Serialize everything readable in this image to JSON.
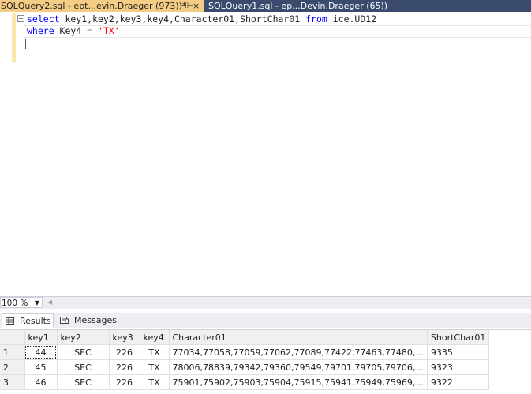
{
  "tabs": [
    {
      "title": "SQLQuery2.sql - ept...evin.Draeger (973))*",
      "pin": "⊣⊢",
      "close": "×",
      "active": true
    },
    {
      "title": "SQLQuery1.sql - ep...Devin.Draeger (65))*",
      "active": false
    }
  ],
  "editor": {
    "line1": {
      "kw1": "select",
      "cols": " key1,key2,key3,key4,Character01,ShortChar01 ",
      "kw2": "from",
      "table": " ice.UD12"
    },
    "line2": {
      "kw": "where",
      "cond": " Key4 ",
      "op": "=",
      "str": " 'TX'"
    }
  },
  "zoom": {
    "value": "100 %"
  },
  "result_tabs": {
    "results": "Results",
    "messages": "Messages"
  },
  "grid": {
    "columns": [
      "key1",
      "key2",
      "key3",
      "key4",
      "Character01",
      "ShortChar01"
    ],
    "rows": [
      {
        "num": "1",
        "key1": "44",
        "key2": "SEC",
        "key3": "226",
        "key4": "TX",
        "char01": "77034,77058,77059,77062,77089,77422,77463,77480,...",
        "short01": "9335"
      },
      {
        "num": "2",
        "key1": "45",
        "key2": "SEC",
        "key3": "226",
        "key4": "TX",
        "char01": "78006,78839,79342,79360,79549,79701,79705,79706,...",
        "short01": "9323"
      },
      {
        "num": "3",
        "key1": "46",
        "key2": "SEC",
        "key3": "226",
        "key4": "TX",
        "char01": "75901,75902,75903,75904,75915,75941,75949,75969,...",
        "short01": "9322"
      }
    ]
  }
}
